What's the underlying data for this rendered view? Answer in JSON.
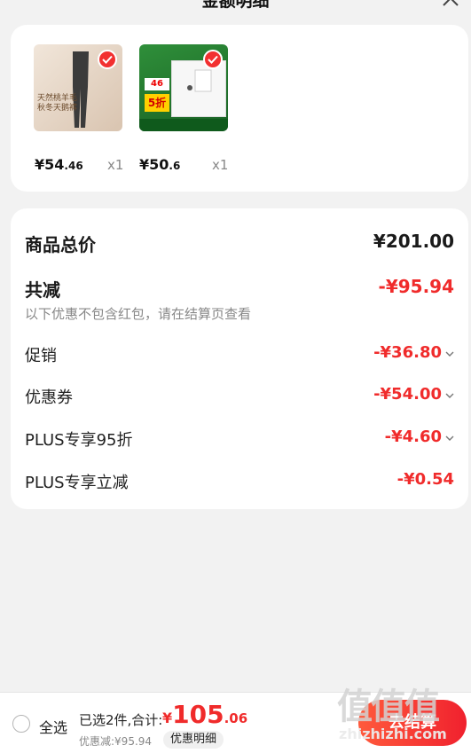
{
  "header": {
    "title": "金额明细"
  },
  "goods": [
    {
      "price_int": "¥54",
      "price_dec": ".46",
      "qty": "x1",
      "thumb_text": "天然桃羊毛\n秋冬天鹅裤"
    },
    {
      "price_int": "¥50",
      "price_dec": ".6",
      "qty": "x1",
      "badge_number": "46",
      "badge_discount": "5折"
    }
  ],
  "breakdown": {
    "total_label": "商品总价",
    "total_value": "¥201.00",
    "saved_label": "共减",
    "saved_value": "-¥95.94",
    "note": "以下优惠不包含红包，请在结算页查看",
    "items": [
      {
        "label": "促销",
        "value": "-¥36.80"
      },
      {
        "label": "优惠券",
        "value": "-¥54.00"
      },
      {
        "label": "PLUS专享95折",
        "value": "-¥4.60"
      },
      {
        "label": "PLUS专享立减",
        "value": "-¥0.54"
      }
    ]
  },
  "footer": {
    "select_all": "全选",
    "summary": "已选2件,合计:",
    "total_yen": "¥",
    "total_int": "105",
    "total_dec": ".06",
    "discount_line": "优惠减:¥95.94",
    "detail_button": "优惠明细",
    "checkout_button": "去结算"
  },
  "watermark": {
    "big": "值值值",
    "small": "zhizhizhi.com"
  },
  "colors": {
    "accent_red": "#f02b2b",
    "background": "#f2f2f2"
  }
}
